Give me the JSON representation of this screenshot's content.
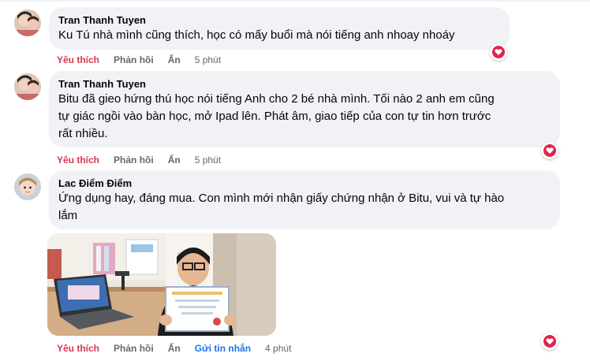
{
  "comments": [
    {
      "author": "Tran Thanh Tuyen",
      "text_lines": [
        "Ku Tú nhà mình cũng thích, học có mấy buổi mà nói tiếng anh nhoay nhoáy"
      ],
      "actions": {
        "like": "Yêu thích",
        "reply": "Phản hồi",
        "hide": "Ẩn",
        "time": "5 phút"
      },
      "reaction_icon": "heart-icon"
    },
    {
      "author": "Tran Thanh Tuyen",
      "text_lines": [
        "Bitu đã gieo hứng thú học nói tiếng Anh cho 2 bé nhà mình. Tối nào 2 anh em cũng",
        "tự giác ngồi vào bàn học, mở Ipad lên. Phát âm, giao tiếp của con tự tin hơn trước",
        "rất nhiều."
      ],
      "actions": {
        "like": "Yêu thích",
        "reply": "Phản hồi",
        "hide": "Ẩn",
        "time": "5 phút"
      },
      "reaction_icon": "heart-icon"
    },
    {
      "author": "Lac Điểm Điểm",
      "text_lines": [
        "Ứng dụng hay, đáng mua. Con mình mới nhận giấy chứng nhận ở Bitu, vui và tự hào",
        "lắm"
      ],
      "actions": {
        "like": "Yêu thích",
        "reply": "Phản hồi",
        "hide": "Ẩn",
        "message": "Gửi tin nhắn",
        "time": "4 phút"
      },
      "reaction_icon": "heart-icon",
      "attachment": "photo"
    }
  ],
  "colors": {
    "bubble": "#f0f2f5",
    "like": "#d43a4c",
    "link": "#1b74e4",
    "muted": "#65676b",
    "heart": "#e0244d"
  }
}
